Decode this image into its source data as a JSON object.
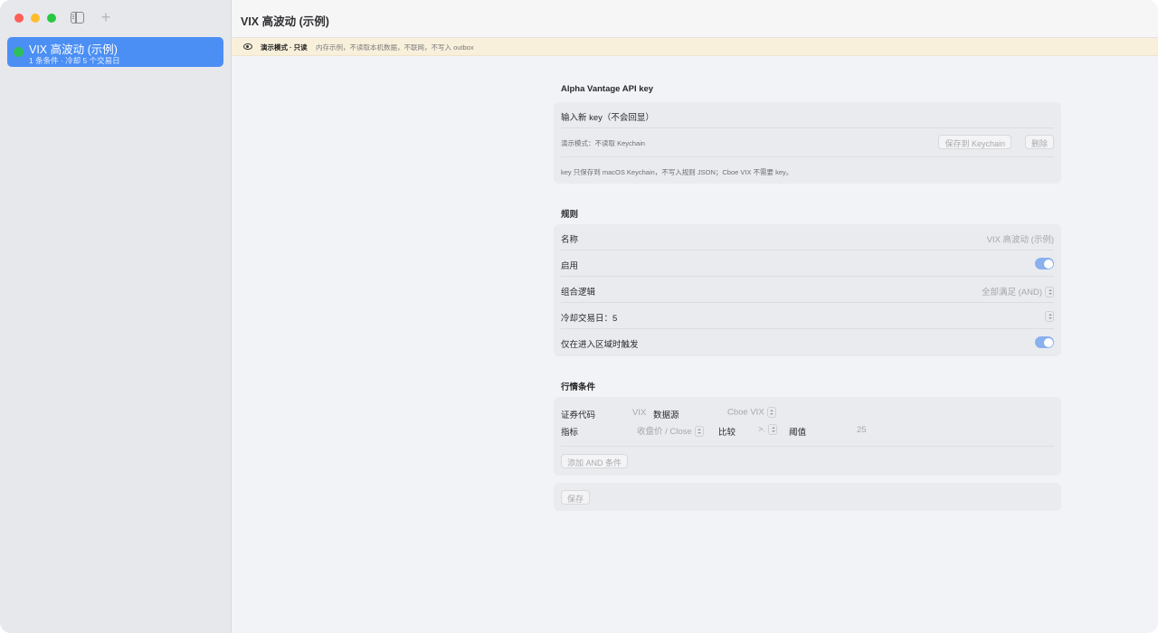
{
  "sidebar": {
    "rule": {
      "title": "VIX 高波动 (示例)",
      "subtitle": "1 条条件 · 冷却 5 个交易日"
    }
  },
  "window": {
    "title": "VIX 高波动 (示例)"
  },
  "banner": {
    "strong": "演示模式 · 只读",
    "text": "内存示例，不读取本机数据，不联网，不写入 outbox"
  },
  "api": {
    "section_title": "Alpha Vantage API key",
    "input_placeholder": "输入新 key（不会回显）",
    "demo_note": "演示模式：不读取 Keychain",
    "save_label": "保存到 Keychain",
    "delete_label": "删除",
    "footnote": "key 只保存到 macOS Keychain，不写入规则 JSON；Cboe VIX 不需要 key。"
  },
  "rules": {
    "section_title": "规则",
    "name_label": "名称",
    "name_value": "VIX 高波动 (示例)",
    "enabled_label": "启用",
    "enabled": true,
    "logic_label": "组合逻辑",
    "logic_value": "全部满足 (AND)",
    "cooldown_label": "冷却交易日：5",
    "edge_label": "仅在进入区域时触发",
    "edge_enabled": true
  },
  "conditions": {
    "section_title": "行情条件",
    "symbol_label": "证券代码",
    "symbol_value": "VIX",
    "source_label": "数据源",
    "source_value": "Cboe VIX",
    "metric_label": "指标",
    "metric_value": "收盘价 / Close",
    "compare_label": "比较",
    "compare_value": ">.",
    "threshold_label": "阈值",
    "threshold_value": "25",
    "add_label": "添加 AND 条件"
  },
  "footer": {
    "save_label": "保存"
  },
  "colors": {
    "accent": "#4b8ff5",
    "status_green": "#2fbf5a",
    "banner_bg": "#f8f0db",
    "toggle_on": "#8ab0ef"
  }
}
